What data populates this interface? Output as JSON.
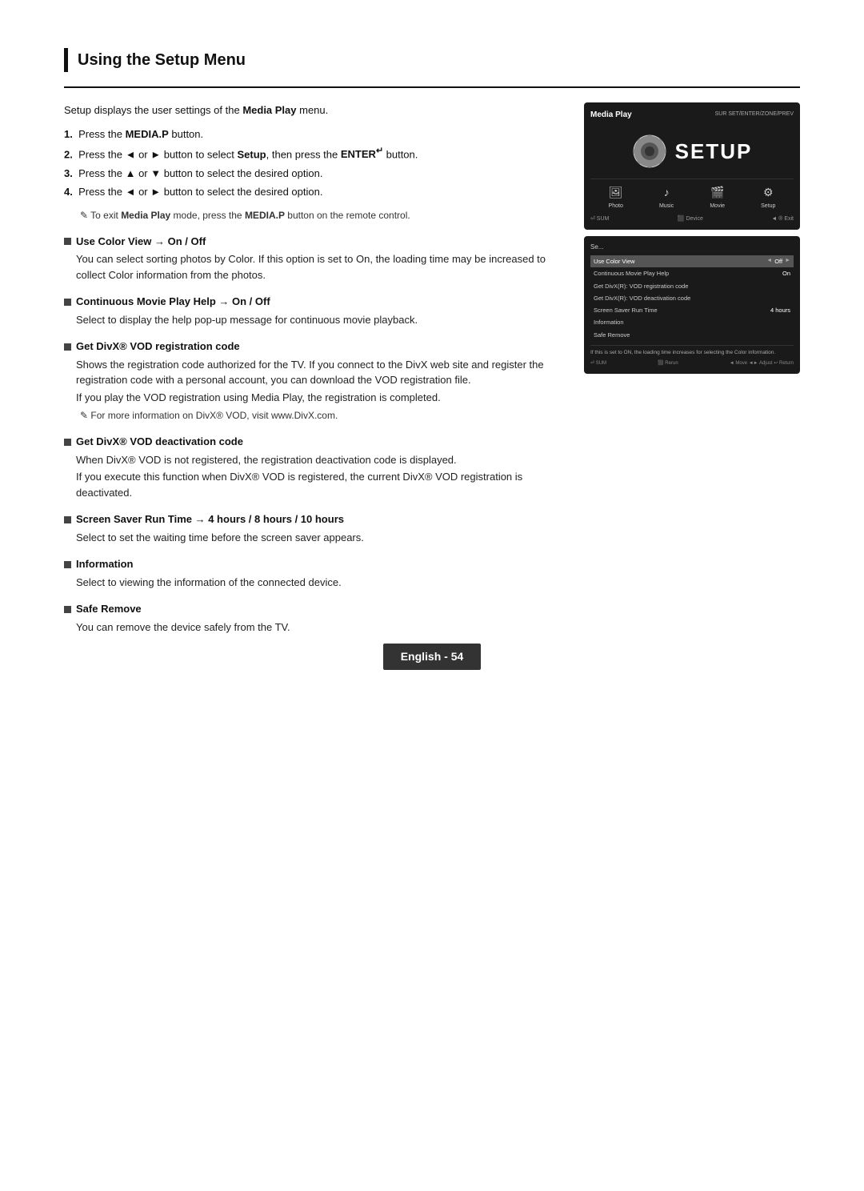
{
  "page": {
    "section_title": "Using the Setup Menu",
    "footer_text": "English - 54"
  },
  "intro": {
    "text": "Setup displays the user settings of the Media Play menu."
  },
  "steps": [
    {
      "num": "1.",
      "text": "Press the ",
      "bold": "MEDIA.P",
      "after": " button."
    },
    {
      "num": "2.",
      "text": "Press the ◄ or ► button to select ",
      "bold": "Setup",
      "middle": ", then press the ",
      "bold2": "ENTER",
      "enter_symbol": "↵",
      "after": " button."
    },
    {
      "num": "3.",
      "text": "Press the ▲ or ▼ button to select the desired option."
    },
    {
      "num": "4.",
      "text": "Press the ◄ or ► button to select the desired option."
    }
  ],
  "note": "To exit Media Play mode, press the MEDIA.P button on the remote control.",
  "bullets": [
    {
      "heading": "Use Color View → On / Off",
      "body": "You can select sorting photos by Color. If this option is set to On, the loading time may be increased to collect Color information from the photos."
    },
    {
      "heading": "Continuous Movie Play Help → On / Off",
      "body": "Select to display the help pop-up message for continuous movie playback."
    },
    {
      "heading": "Get DivX® VOD registration code",
      "body1": "Shows the registration code authorized for the TV. If you connect to the DivX web site and register the registration code with a personal account, you can download the VOD registration file.",
      "body2": "If you play the VOD registration using Media Play, the registration is completed.",
      "note2": "For more information on DivX® VOD, visit www.DivX.com."
    },
    {
      "heading": "Get DivX® VOD deactivation code",
      "body1": "When DivX® VOD is not registered, the registration deactivation code is displayed.",
      "body2": "If you execute this function when DivX® VOD is registered, the current DivX® VOD registration is deactivated."
    },
    {
      "heading": "Screen Saver Run Time → 4 hours / 8 hours / 10 hours",
      "body": "Select to set the waiting time before the screen saver appears."
    },
    {
      "heading": "Information",
      "body": "Select to viewing the information of the connected device."
    },
    {
      "heading": "Safe Remove",
      "body": "You can remove the device safely from the TV."
    }
  ],
  "tv_top": {
    "title": "Media Play",
    "sub": "SUR SET/ENTER/ZONE/PREV",
    "setup_label": "SETUP",
    "icons": [
      {
        "label": "Photo",
        "icon": "🖼"
      },
      {
        "label": "Music",
        "icon": "♪"
      },
      {
        "label": "Movie",
        "icon": "🎬"
      },
      {
        "label": "Setup",
        "icon": "⚙"
      }
    ],
    "bottom_left": "⏎ SUM",
    "bottom_right": "◄ ® Exit"
  },
  "tv_bot": {
    "title": "Se...",
    "rows": [
      {
        "label": "Use Color View",
        "value": "Off",
        "arrows": true,
        "highlighted": true
      },
      {
        "label": "Continuous Movie Play Help",
        "value": "On",
        "arrows": false
      },
      {
        "label": "Get DivX(R) VOD registration code",
        "value": "",
        "arrows": false
      },
      {
        "label": "Get DivX(R) VOD deactivation code",
        "value": "",
        "arrows": false
      },
      {
        "label": "Screen Saver Run Time",
        "value": "4 hours",
        "arrows": false
      },
      {
        "label": "Information",
        "value": "",
        "arrows": false
      },
      {
        "label": "Safe Remove",
        "value": "",
        "arrows": false
      }
    ],
    "note": "If this is set to ON, the loading time increases for selecting the Color information.",
    "bottom_left": "⏎ SUM",
    "bottom_middle": "⬛ Rerun",
    "bottom_right": "◄ Move  ◄ Adjust  ↩ Return"
  }
}
